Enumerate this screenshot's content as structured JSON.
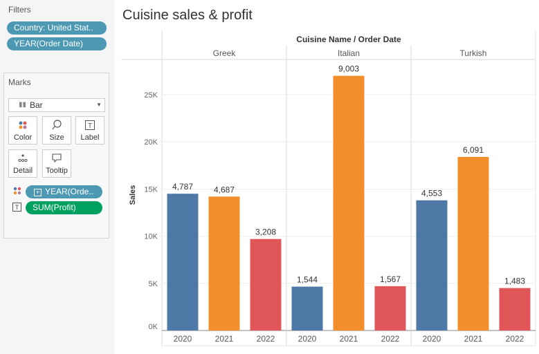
{
  "filters": {
    "title": "Filters",
    "items": [
      "Country: United Stat..",
      "YEAR(Order Date)"
    ]
  },
  "marks": {
    "title": "Marks",
    "type": "Bar",
    "buttons": [
      {
        "label": "Color",
        "icon": "color-dots-icon"
      },
      {
        "label": "Size",
        "icon": "size-lasso-icon"
      },
      {
        "label": "Label",
        "icon": "label-t-icon"
      },
      {
        "label": "Detail",
        "icon": "detail-dots-icon"
      },
      {
        "label": "Tooltip",
        "icon": "tooltip-bubble-icon"
      }
    ],
    "fields": [
      {
        "label": "YEAR(Orde..",
        "encoding": "color",
        "color": "#4d98b3"
      },
      {
        "label": "SUM(Profit)",
        "encoding": "label",
        "color": "#00a060"
      }
    ]
  },
  "chart_data": {
    "type": "bar",
    "title": "Cuisine sales & profit",
    "header": "Cuisine Name / Order Date",
    "ylabel": "Sales",
    "ylim": [
      0,
      28000
    ],
    "yticks": [
      0,
      5000,
      10000,
      15000,
      20000,
      25000
    ],
    "ytick_labels": [
      "0K",
      "5K",
      "10K",
      "15K",
      "20K",
      "25K"
    ],
    "year_colors": {
      "2020": "#4e79a7",
      "2021": "#f28e2b",
      "2022": "#e15759"
    },
    "groups": [
      {
        "name": "Greek",
        "bars": [
          {
            "year": "2020",
            "sales": 14500,
            "profit_label": "4,787"
          },
          {
            "year": "2021",
            "sales": 14200,
            "profit_label": "4,687"
          },
          {
            "year": "2022",
            "sales": 9700,
            "profit_label": "3,208"
          }
        ]
      },
      {
        "name": "Italian",
        "bars": [
          {
            "year": "2020",
            "sales": 4650,
            "profit_label": "1,544"
          },
          {
            "year": "2021",
            "sales": 27000,
            "profit_label": "9,003"
          },
          {
            "year": "2022",
            "sales": 4700,
            "profit_label": "1,567"
          }
        ]
      },
      {
        "name": "Turkish",
        "bars": [
          {
            "year": "2020",
            "sales": 13800,
            "profit_label": "4,553"
          },
          {
            "year": "2021",
            "sales": 18400,
            "profit_label": "6,091"
          },
          {
            "year": "2022",
            "sales": 4500,
            "profit_label": "1,483"
          }
        ]
      }
    ]
  }
}
